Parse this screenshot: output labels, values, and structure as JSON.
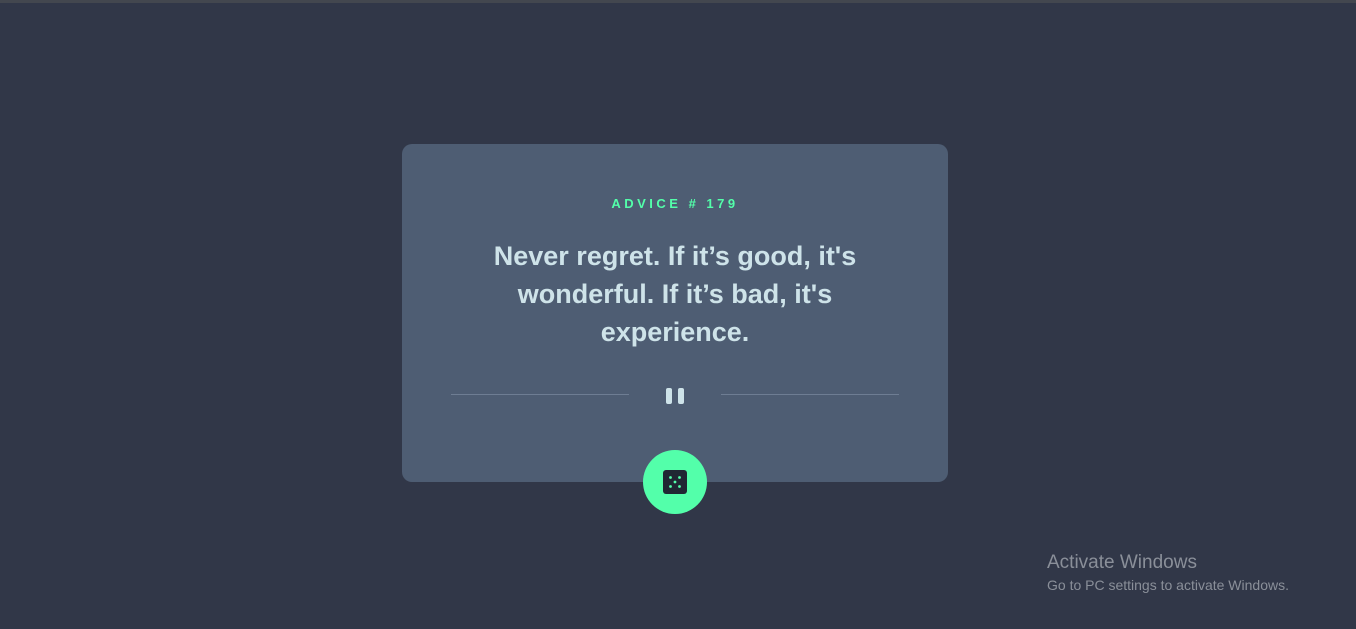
{
  "advice": {
    "number_label": "ADVICE # 179",
    "text": "Never regret. If it’s good, it's wonderful. If it’s bad, it's experience."
  },
  "divider": {
    "icon": "pause-icon"
  },
  "dice_button": {
    "icon": "dice-icon"
  },
  "watermark": {
    "title": "Activate Windows",
    "subtitle": "Go to PC settings to activate Windows."
  },
  "colors": {
    "background": "#313748",
    "card": "#4e5d73",
    "accent": "#53ffaa",
    "text": "#cee3e9"
  }
}
